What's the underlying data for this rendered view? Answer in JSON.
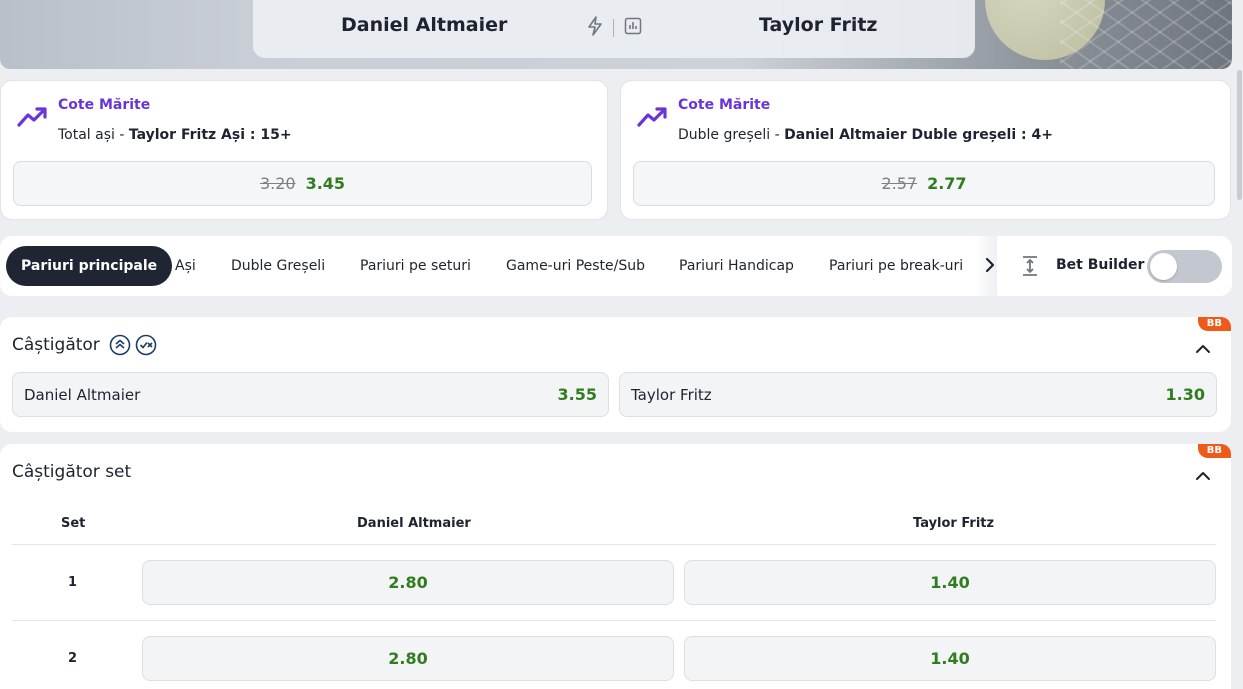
{
  "match": {
    "home": "Daniel Altmaier",
    "away": "Taylor Fritz"
  },
  "promos": [
    {
      "title": "Cote Mărite",
      "desc_prefix": "Total ași - ",
      "desc_bold": "Taylor Fritz Ași : 15+",
      "old_odds": "3.20",
      "new_odds": "3.45"
    },
    {
      "title": "Cote Mărite",
      "desc_prefix": "Duble greșeli - ",
      "desc_bold": "Daniel Altmaier Duble greșeli : 4+",
      "old_odds": "2.57",
      "new_odds": "2.77"
    }
  ],
  "tabs": [
    "Pariuri principale",
    "Ași",
    "Duble Greșeli",
    "Pariuri pe seturi",
    "Game-uri Peste/Sub",
    "Pariuri Handicap",
    "Pariuri pe break-uri"
  ],
  "bet_builder": {
    "label": "Bet Builder",
    "enabled": false
  },
  "market_winner": {
    "title": "Câștigător",
    "badge": "BB",
    "outcomes": [
      {
        "name": "Daniel Altmaier",
        "odds": "3.55"
      },
      {
        "name": "Taylor Fritz",
        "odds": "1.30"
      }
    ]
  },
  "market_set_winner": {
    "title": "Câștigător set",
    "badge": "BB",
    "columns": [
      "Set",
      "Daniel Altmaier",
      "Taylor Fritz"
    ],
    "rows": [
      {
        "set": "1",
        "home": "2.80",
        "away": "1.40"
      },
      {
        "set": "2",
        "home": "2.80",
        "away": "1.40"
      }
    ]
  },
  "colors": {
    "accent_purple": "#6a35d8",
    "odds_green": "#2f7d1e",
    "badge_orange": "#ee5a1a",
    "active_tab": "#1f2533"
  }
}
